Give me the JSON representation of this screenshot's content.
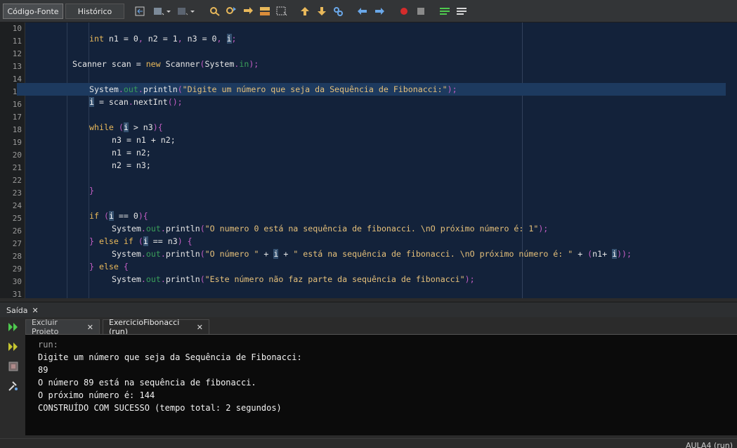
{
  "toolbar": {
    "source_tab": "Código-Fonte",
    "history_tab": "Histórico",
    "icons": [
      "last-edit-icon",
      "back-icon",
      "forward-icon",
      "find-icon",
      "find-prev-icon",
      "find-next-icon",
      "toggle-highlight-icon",
      "select-icon",
      "prev-bookmark-icon",
      "next-bookmark-icon",
      "toggle-bookmark-icon",
      "shift-left-icon",
      "shift-right-icon",
      "record-macro-icon",
      "stop-macro-icon",
      "comment-icon",
      "uncomment-icon"
    ]
  },
  "editor": {
    "line_numbers": [
      "10",
      "11",
      "12",
      "13",
      "14",
      "15",
      "16",
      "17",
      "18",
      "19",
      "20",
      "21",
      "22",
      "23",
      "24",
      "25",
      "26",
      "27",
      "28",
      "29",
      "30",
      "31"
    ]
  },
  "code": {
    "l11": {
      "kw": "int",
      "a": " n1 = 0",
      "b": " n2 = 1",
      "c": " n3 = 0",
      "v": "i"
    },
    "l13": {
      "a": "Scanner scan = ",
      "kw": "new",
      "b": " Scanner",
      "c": "System",
      "d": "in"
    },
    "l15": {
      "a": "System",
      "f": "out",
      "b": "println",
      "s": "\"Digite um número que seja da Sequência de Fibonacci:\""
    },
    "l16": {
      "v": "i",
      "a": " = scan",
      "b": "nextInt"
    },
    "l18": {
      "kw": "while",
      "v": "i",
      "a": " > n3"
    },
    "l19": "n3 = n1 + n2;",
    "l20": "n1 = n2;",
    "l21": "n2 = n3;",
    "l23": "}",
    "l25": {
      "kw": "if",
      "v": "i",
      "a": " == 0"
    },
    "l26": {
      "a": "System",
      "f": "out",
      "b": "println",
      "s": "\"O numero 0 está na sequência de fibonacci. \\nO próximo número é: 1\""
    },
    "l27": {
      "kw": "else if",
      "v": "i",
      "a": " == n3"
    },
    "l28": {
      "a": "System",
      "f": "out",
      "b": "println",
      "s1": "\"O número \"",
      "v": "i",
      "s2": "\" está na sequência de fibonacci. \\nO próximo número é: \"",
      "c": "n1+ ",
      "v2": "i"
    },
    "l29": {
      "kw": "else"
    },
    "l30": {
      "a": "System",
      "f": "out",
      "b": "println",
      "s": "\"Este número não faz parte da sequência de fibonacci\""
    }
  },
  "output": {
    "panel_title": "Saída",
    "run_tabs": [
      "Excluir Projeto",
      "ExercicioFibonacci (run)"
    ],
    "lines": [
      "run:",
      "Digite um número que seja da Sequência de Fibonacci:",
      "89",
      "O número 89 está na sequência de fibonacci.",
      "O próximo número é: 144",
      "CONSTRUÍDO COM SUCESSO (tempo total: 2 segundos)"
    ]
  },
  "status": {
    "text": "AULA4 (run)"
  }
}
